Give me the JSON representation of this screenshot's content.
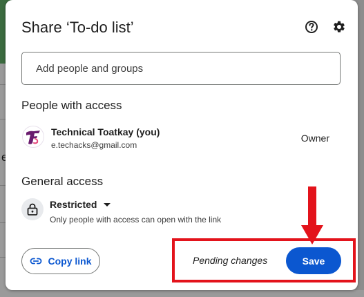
{
  "dialog": {
    "title": "Share ‘To-do list’",
    "help_icon": "help-circle-icon",
    "settings_icon": "gear-icon"
  },
  "add_people": {
    "placeholder": "Add people and groups"
  },
  "people_with_access": {
    "heading": "People with access",
    "people": [
      {
        "name": "Technical Toatkay (you)",
        "email": "e.techacks@gmail.com",
        "role": "Owner",
        "avatar_icon": "tt-logo-avatar"
      }
    ]
  },
  "general_access": {
    "heading": "General access",
    "level": "Restricted",
    "description": "Only people with access can open with the link",
    "icon": "lock-icon"
  },
  "footer": {
    "copy_link_label": "Copy link",
    "copy_link_icon": "link-icon",
    "pending_text": "Pending changes",
    "save_label": "Save"
  },
  "background": {
    "left_glyph": "e"
  },
  "colors": {
    "primary_blue": "#0b57d0",
    "annotation_red": "#e3131b",
    "avatar_purple": "#6a1b6e"
  }
}
